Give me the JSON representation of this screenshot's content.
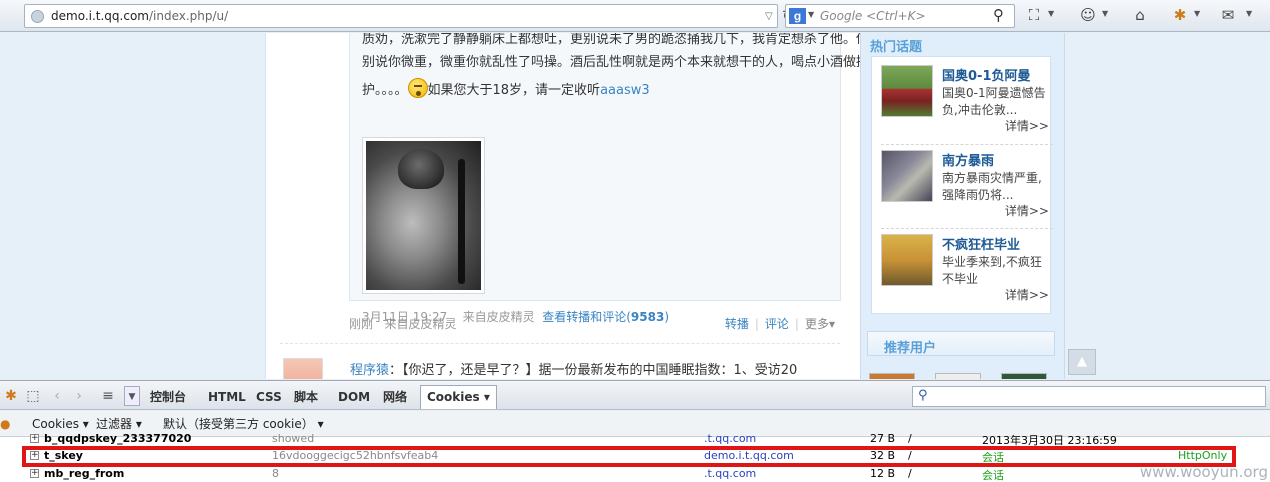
{
  "browser": {
    "url_domain": "demo.i.t.qq.com",
    "url_path": "/index.php/u/",
    "search_engine_letter": "g",
    "search_placeholder": "Google <Ctrl+K>"
  },
  "post": {
    "lines": [
      "质劝，洗漱完了静静躺床上都想吐，更别说未了男的跪恣捅我几下，我肯定想杀了他。你",
      "别说你微重，微重你就乱性了吗操。酒后乱性啊就是两个本来就想干的人，喝点小酒做摘",
      "护。。。。",
      "如果您大于18岁，请一定收听",
      "aaasw3"
    ],
    "quote_time": "3月11日 19:27",
    "quote_source": "来自皮皮精灵",
    "quote_link": "查看转播和评论(",
    "quote_count": "9583",
    "quote_close": ")",
    "footer_time": "刚刚",
    "footer_source": "来自皮皮精灵",
    "action_forward": "转播",
    "action_comment": "评论",
    "action_more": "更多▾"
  },
  "next_post": {
    "author": "程序猿",
    "text": "：【你迟了，还是早了？】据一份最新发布的中国睡眠指数：1、受访20"
  },
  "sidebar": {
    "hot_title": "热门话题",
    "topics": [
      {
        "title": "国奥0-1负阿曼",
        "body": "国奥0-1阿曼遗憾告负,冲击伦敦...",
        "more": "详情>>"
      },
      {
        "title": "南方暴雨",
        "body": "南方暴雨灾情严重,强降雨仍将...",
        "more": "详情>>"
      },
      {
        "title": "不疯狂枉毕业",
        "body": "毕业季来到,不疯狂不毕业",
        "more": "详情>>"
      }
    ],
    "recommend_title": "推荐用户"
  },
  "firebug": {
    "tabs": [
      "控制台",
      "HTML",
      "CSS",
      "脚本",
      "DOM",
      "网络",
      "Cookies ▾"
    ],
    "sub_cookies": "Cookies ▾",
    "sub_filter": "过滤器 ▾",
    "sub_default": "默认（接受第三方 cookie） ▾"
  },
  "cookies": [
    {
      "name": "b_qqdpskey_233377020",
      "value": "showed",
      "domain": ".t.qq.com",
      "size": "27 B",
      "path": "/",
      "expires": "2013年3月30日 23:16:59",
      "httponly": ""
    },
    {
      "name": "t_skey",
      "value": "16vdooggecigc52hbnfsvfeab4",
      "domain": "demo.i.t.qq.com",
      "size": "32 B",
      "path": "/",
      "expires": "会话",
      "httponly": "HttpOnly"
    },
    {
      "name": "mb_reg_from",
      "value": "8",
      "domain": ".t.qq.com",
      "size": "12 B",
      "path": "/",
      "expires": "会话",
      "httponly": ""
    }
  ],
  "watermark": "www.wooyun.org",
  "colors": {
    "highlight": "#e01515",
    "link": "#3a84c4",
    "session_green": "#19a019",
    "domain_blue": "#2a3fbf"
  }
}
